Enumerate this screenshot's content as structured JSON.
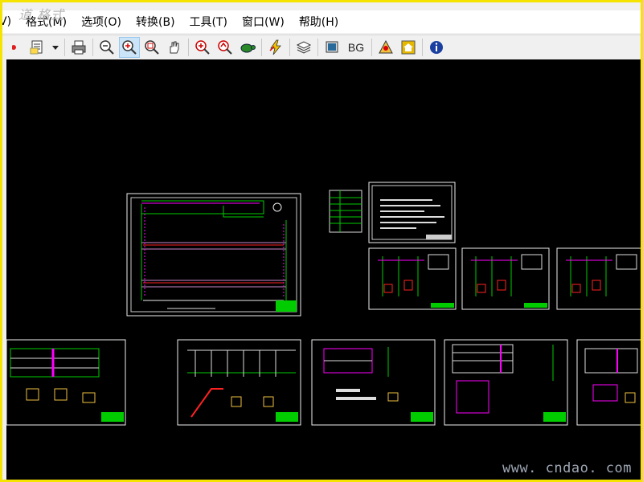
{
  "watermark_top": "道 格式",
  "watermark_bottom": "www. cndao. com",
  "menu": [
    "V)",
    "格式(M)",
    "选项(O)",
    "转换(B)",
    "工具(T)",
    "窗口(W)",
    "帮助(H)"
  ],
  "toolbar": {
    "items": [
      "red-dot-icon",
      "open-file-icon",
      "dropdown-arrow-icon",
      "separator",
      "print-icon",
      "separator",
      "zoom-out-icon",
      "zoom-in-icon",
      "zoom-window-icon",
      "pan-hand-icon",
      "separator",
      "zoom-realtime-icon",
      "zoom-previous-icon",
      "turtle-icon",
      "separator",
      "lightning-icon",
      "separator",
      "layers-icon",
      "separator",
      "display-icon",
      "bg-text",
      "separator",
      "measure-icon",
      "home-icon",
      "separator",
      "info-icon"
    ],
    "pressed": "zoom-in-icon",
    "bg_label": "BG"
  },
  "colors": {
    "border": "#f5e400",
    "canvas": "#000000",
    "green": "#00c800",
    "magenta": "#ff00ff",
    "red": "#ff2020"
  }
}
